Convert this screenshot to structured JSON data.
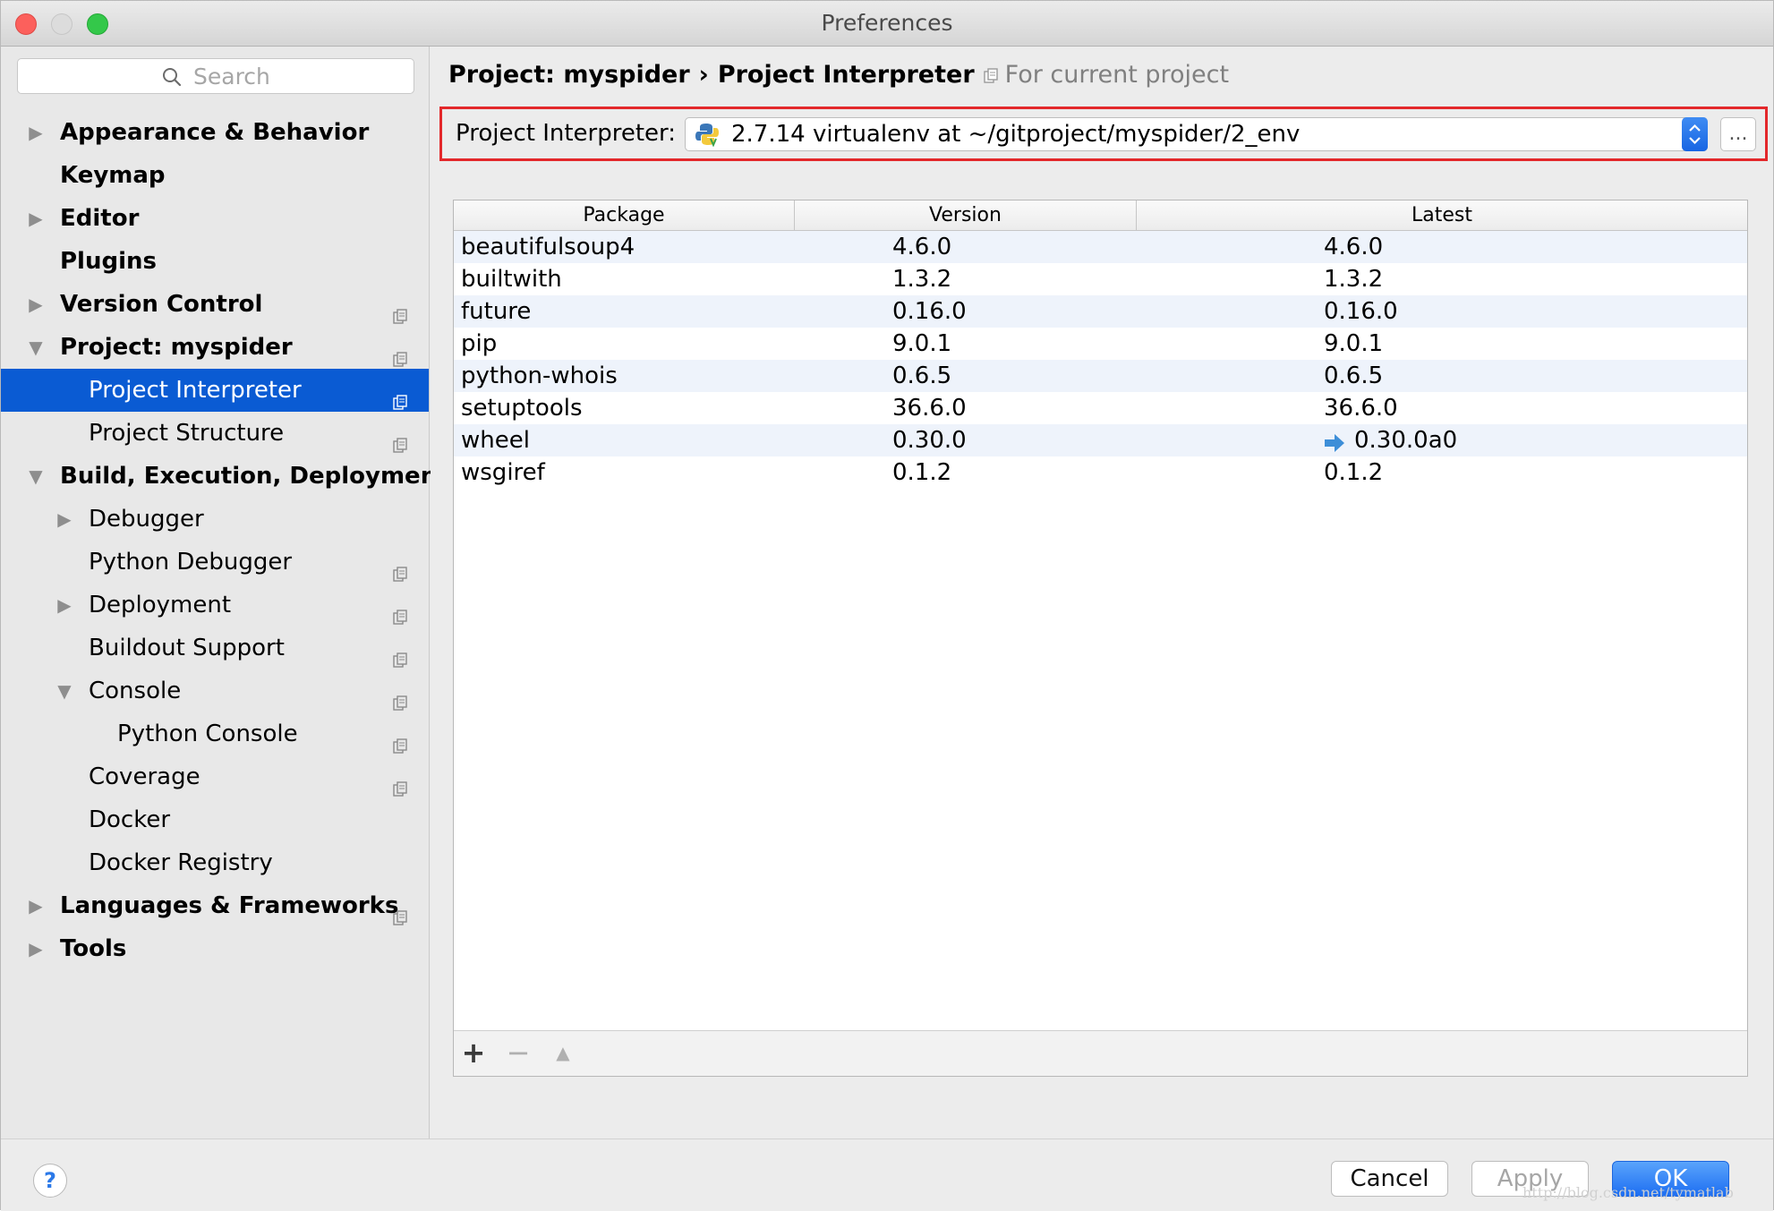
{
  "window": {
    "title": "Preferences"
  },
  "search": {
    "placeholder": "Search"
  },
  "sidebar": {
    "items": [
      {
        "label": "Appearance & Behavior",
        "level": 0,
        "arrow": "right",
        "bold": true,
        "copy": false,
        "selected": false
      },
      {
        "label": "Keymap",
        "level": 0,
        "arrow": "none",
        "bold": true,
        "copy": false,
        "selected": false
      },
      {
        "label": "Editor",
        "level": 0,
        "arrow": "right",
        "bold": true,
        "copy": false,
        "selected": false
      },
      {
        "label": "Plugins",
        "level": 0,
        "arrow": "none",
        "bold": true,
        "copy": false,
        "selected": false
      },
      {
        "label": "Version Control",
        "level": 0,
        "arrow": "right",
        "bold": true,
        "copy": true,
        "selected": false
      },
      {
        "label": "Project: myspider",
        "level": 0,
        "arrow": "down",
        "bold": true,
        "copy": true,
        "selected": false
      },
      {
        "label": "Project Interpreter",
        "level": 1,
        "arrow": "none",
        "bold": false,
        "copy": true,
        "selected": true
      },
      {
        "label": "Project Structure",
        "level": 1,
        "arrow": "none",
        "bold": false,
        "copy": true,
        "selected": false
      },
      {
        "label": "Build, Execution, Deployment",
        "level": 0,
        "arrow": "down",
        "bold": true,
        "copy": false,
        "selected": false
      },
      {
        "label": "Debugger",
        "level": 1,
        "arrow": "right",
        "bold": false,
        "copy": false,
        "selected": false
      },
      {
        "label": "Python Debugger",
        "level": 1,
        "arrow": "none",
        "bold": false,
        "copy": true,
        "selected": false
      },
      {
        "label": "Deployment",
        "level": 1,
        "arrow": "right",
        "bold": false,
        "copy": true,
        "selected": false
      },
      {
        "label": "Buildout Support",
        "level": 1,
        "arrow": "none",
        "bold": false,
        "copy": true,
        "selected": false
      },
      {
        "label": "Console",
        "level": 1,
        "arrow": "down",
        "bold": false,
        "copy": true,
        "selected": false
      },
      {
        "label": "Python Console",
        "level": 2,
        "arrow": "none",
        "bold": false,
        "copy": true,
        "selected": false
      },
      {
        "label": "Coverage",
        "level": 1,
        "arrow": "none",
        "bold": false,
        "copy": true,
        "selected": false
      },
      {
        "label": "Docker",
        "level": 1,
        "arrow": "none",
        "bold": false,
        "copy": false,
        "selected": false
      },
      {
        "label": "Docker Registry",
        "level": 1,
        "arrow": "none",
        "bold": false,
        "copy": false,
        "selected": false
      },
      {
        "label": "Languages & Frameworks",
        "level": 0,
        "arrow": "right",
        "bold": true,
        "copy": true,
        "selected": false
      },
      {
        "label": "Tools",
        "level": 0,
        "arrow": "right",
        "bold": true,
        "copy": false,
        "selected": false
      }
    ]
  },
  "breadcrumb": {
    "project": "Project: myspider",
    "separator": "›",
    "page": "Project Interpreter",
    "scope": "For current project"
  },
  "interpreter": {
    "label": "Project Interpreter:",
    "value": "2.7.14 virtualenv at ~/gitproject/myspider/2_env",
    "more_label": "..."
  },
  "packages": {
    "columns": [
      "Package",
      "Version",
      "Latest"
    ],
    "rows": [
      {
        "package": "beautifulsoup4",
        "version": "4.6.0",
        "latest": "4.6.0",
        "upgrade": false
      },
      {
        "package": "builtwith",
        "version": "1.3.2",
        "latest": "1.3.2",
        "upgrade": false
      },
      {
        "package": "future",
        "version": "0.16.0",
        "latest": "0.16.0",
        "upgrade": false
      },
      {
        "package": "pip",
        "version": "9.0.1",
        "latest": "9.0.1",
        "upgrade": false
      },
      {
        "package": "python-whois",
        "version": "0.6.5",
        "latest": "0.6.5",
        "upgrade": false
      },
      {
        "package": "setuptools",
        "version": "36.6.0",
        "latest": "36.6.0",
        "upgrade": false
      },
      {
        "package": "wheel",
        "version": "0.30.0",
        "latest": "0.30.0a0",
        "upgrade": true
      },
      {
        "package": "wsgiref",
        "version": "0.1.2",
        "latest": "0.1.2",
        "upgrade": false
      }
    ],
    "toolbar": {
      "add": "+",
      "remove": "−",
      "upgrade": "▲"
    }
  },
  "footer": {
    "help": "?",
    "cancel": "Cancel",
    "apply": "Apply",
    "ok": "OK",
    "watermark": "http://blog.csdn.net/tymatlab"
  },
  "colors": {
    "selection": "#0a5bd3",
    "highlight_border": "#e3282b",
    "ok_button": "#1d6ef2",
    "upgrade_arrow": "#3d8ed8"
  }
}
